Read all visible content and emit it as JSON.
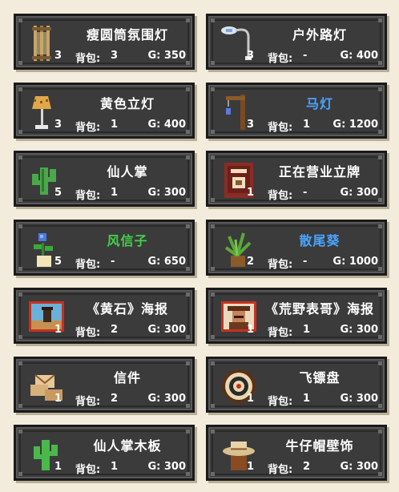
{
  "labels": {
    "bag": "背包:",
    "gold_prefix": "G:"
  },
  "colors": {
    "blue": "#4aa3ff",
    "green": "#3fd24a",
    "white": "#ffffff"
  },
  "items": [
    {
      "name": "瘦圆筒氛围灯",
      "count": "3",
      "bag": "3",
      "gold": "350",
      "icon": "bamboo-lamp-icon",
      "color": "white"
    },
    {
      "name": "户外路灯",
      "count": "3",
      "bag": "-",
      "gold": "400",
      "icon": "street-lamp-icon",
      "color": "white"
    },
    {
      "name": "黄色立灯",
      "count": "3",
      "bag": "1",
      "gold": "400",
      "icon": "yellow-floor-lamp-icon",
      "color": "white"
    },
    {
      "name": "马灯",
      "count": "3",
      "bag": "1",
      "gold": "1200",
      "icon": "lantern-post-icon",
      "color": "blue"
    },
    {
      "name": "仙人掌",
      "count": "5",
      "bag": "1",
      "gold": "300",
      "icon": "cactus-icon",
      "color": "white"
    },
    {
      "name": "正在营业立牌",
      "count": "1",
      "bag": "-",
      "gold": "300",
      "icon": "open-sign-icon",
      "color": "white"
    },
    {
      "name": "风信子",
      "count": "5",
      "bag": "-",
      "gold": "650",
      "icon": "hyacinth-pot-icon",
      "color": "green"
    },
    {
      "name": "散尾葵",
      "count": "2",
      "bag": "-",
      "gold": "1000",
      "icon": "areca-palm-icon",
      "color": "blue"
    },
    {
      "name": "《黄石》海报",
      "count": "1",
      "bag": "2",
      "gold": "300",
      "icon": "yellowstone-poster-icon",
      "color": "white"
    },
    {
      "name": "《荒野表哥》海报",
      "count": "1",
      "bag": "1",
      "gold": "300",
      "icon": "wild-cousin-poster-icon",
      "color": "white"
    },
    {
      "name": "信件",
      "count": "1",
      "bag": "2",
      "gold": "300",
      "icon": "letters-icon",
      "color": "white"
    },
    {
      "name": "飞镖盘",
      "count": "1",
      "bag": "1",
      "gold": "300",
      "icon": "dartboard-icon",
      "color": "white"
    },
    {
      "name": "仙人掌木板",
      "count": "1",
      "bag": "1",
      "gold": "300",
      "icon": "cactus-board-icon",
      "color": "white"
    },
    {
      "name": "牛仔帽壁饰",
      "count": "1",
      "bag": "2",
      "gold": "300",
      "icon": "cowboy-hat-wall-icon",
      "color": "white"
    }
  ]
}
